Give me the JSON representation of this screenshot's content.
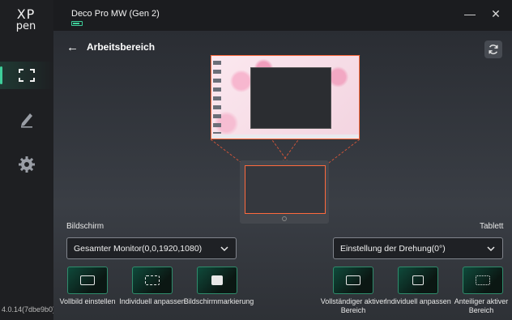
{
  "app": {
    "logo_line1": "XP",
    "logo_line2": "pen",
    "version": "4.0.14(7dbe9b0)"
  },
  "titlebar": {
    "device_name": "Deco Pro MW (Gen 2)",
    "minimize_glyph": "—",
    "close_glyph": "✕"
  },
  "sidebar": {
    "items": [
      {
        "name": "work-area",
        "icon": "fullscreen-icon",
        "active": true
      },
      {
        "name": "pen",
        "icon": "pen-icon",
        "active": false
      },
      {
        "name": "settings",
        "icon": "gear-icon",
        "active": false
      }
    ]
  },
  "page": {
    "back_glyph": "←",
    "title": "Arbeitsbereich"
  },
  "screen_section": {
    "label": "Bildschirm",
    "select_value": "Gesamter Monitor(0,0,1920,1080)",
    "buttons": [
      {
        "label": "Vollbild einstellen",
        "icon": "fullscreen-rect-icon"
      },
      {
        "label": "Individuell anpassen",
        "icon": "custom-area-icon"
      },
      {
        "label": "Bildschirmmarkierung",
        "icon": "screen-mark-icon"
      }
    ]
  },
  "tablet_section": {
    "label": "Tablett",
    "select_value": "Einstellung der Drehung(0°)",
    "buttons": [
      {
        "label": "Vollständiger aktiver Bereich",
        "icon": "full-active-area-icon"
      },
      {
        "label": "Individuell anpassen",
        "icon": "custom-area-icon"
      },
      {
        "label": "Anteiliger aktiver Bereich",
        "icon": "proportional-area-icon"
      }
    ]
  },
  "colors": {
    "accent": "#3ecf9a",
    "mapping_outline": "#ff6a3d"
  }
}
